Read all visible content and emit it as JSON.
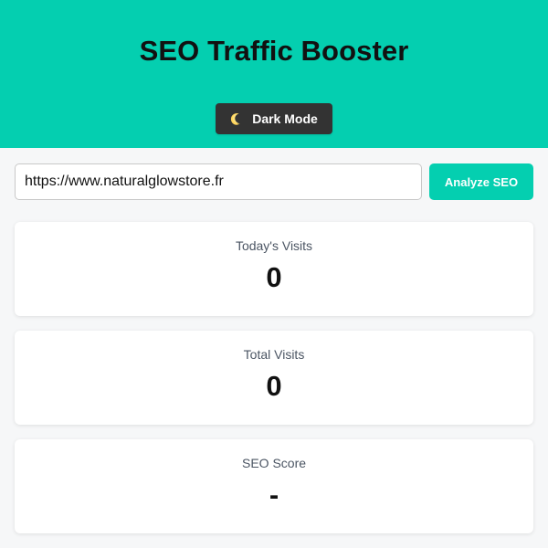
{
  "header": {
    "title": "SEO Traffic Booster",
    "dark_mode_label": "Dark Mode",
    "dark_mode_icon": "moon-icon"
  },
  "analysis": {
    "url_value": "https://www.naturalglowstore.fr",
    "analyze_label": "Analyze SEO"
  },
  "stats": [
    {
      "label": "Today's Visits",
      "value": "0"
    },
    {
      "label": "Total Visits",
      "value": "0"
    },
    {
      "label": "SEO Score",
      "value": "-"
    }
  ],
  "colors": {
    "accent": "#04cfb0",
    "dark_button": "#333333",
    "background": "#f6f7f8",
    "card": "#ffffff",
    "text": "#111111"
  }
}
